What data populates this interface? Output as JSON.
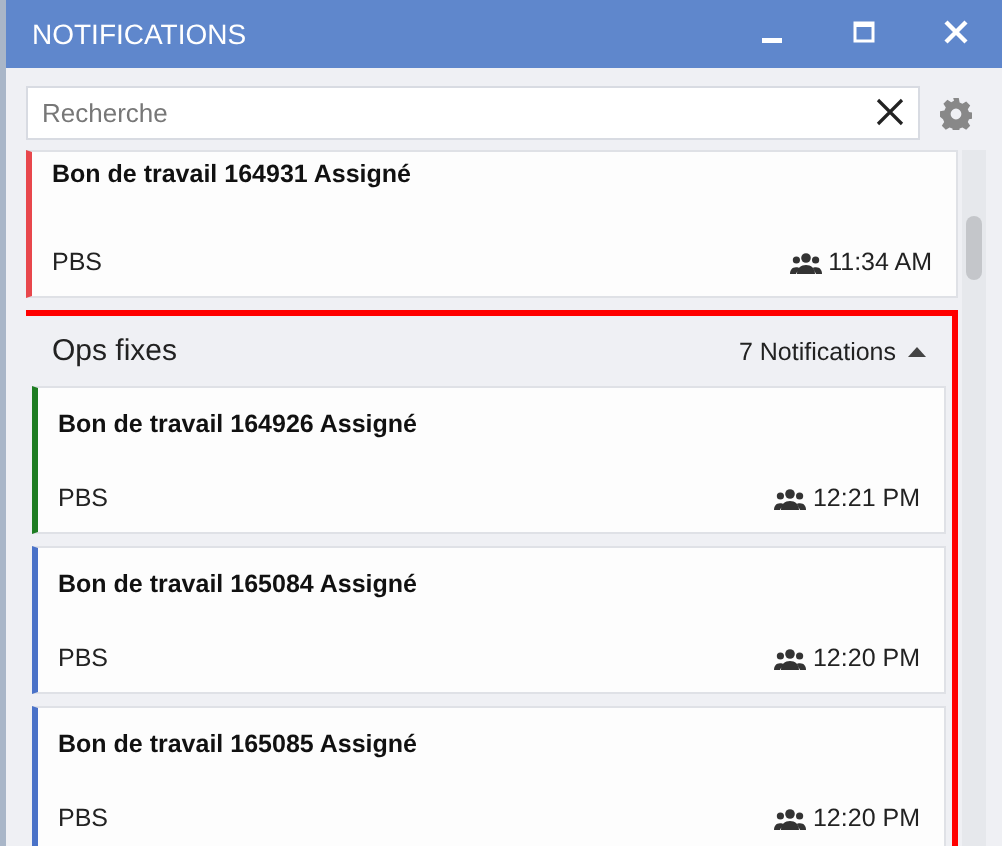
{
  "window": {
    "title": "NOTIFICATIONS"
  },
  "search": {
    "placeholder": "Recherche"
  },
  "notifications": [
    {
      "title": "Bon de travail 164931 Assigné",
      "source": "PBS",
      "time": "11:34 AM",
      "color": "#e8474c"
    }
  ],
  "groups": [
    {
      "name": "Ops fixes",
      "count": "7 Notifications",
      "expanded": true,
      "highlighted": true,
      "items": [
        {
          "title": "Bon de travail 164926 Assigné",
          "source": "PBS",
          "time": "12:21 PM",
          "color": "#1e7d22"
        },
        {
          "title": "Bon de travail 165084 Assigné",
          "source": "PBS",
          "time": "12:20 PM",
          "color": "#4a72c8"
        },
        {
          "title": "Bon de travail 165085 Assigné",
          "source": "PBS",
          "time": "12:20 PM",
          "color": "#4a72c8"
        }
      ]
    }
  ]
}
